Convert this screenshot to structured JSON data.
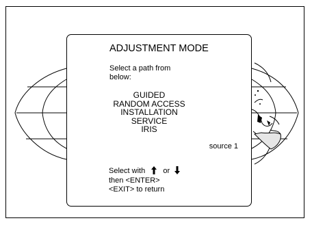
{
  "dialog": {
    "title": "ADJUSTMENT MODE",
    "prompt_line1": "Select a path from",
    "prompt_line2": "below:",
    "menu_items": [
      "GUIDED",
      "RANDOM ACCESS",
      "INSTALLATION",
      "SERVICE",
      "IRIS"
    ],
    "source": "source 1",
    "help": {
      "select_with": "Select with",
      "or": "or",
      "then": "then <ENTER>",
      "exit": "<EXIT> to return"
    }
  },
  "icons": [
    "globe-background",
    "arrow-up-icon",
    "arrow-down-icon"
  ]
}
